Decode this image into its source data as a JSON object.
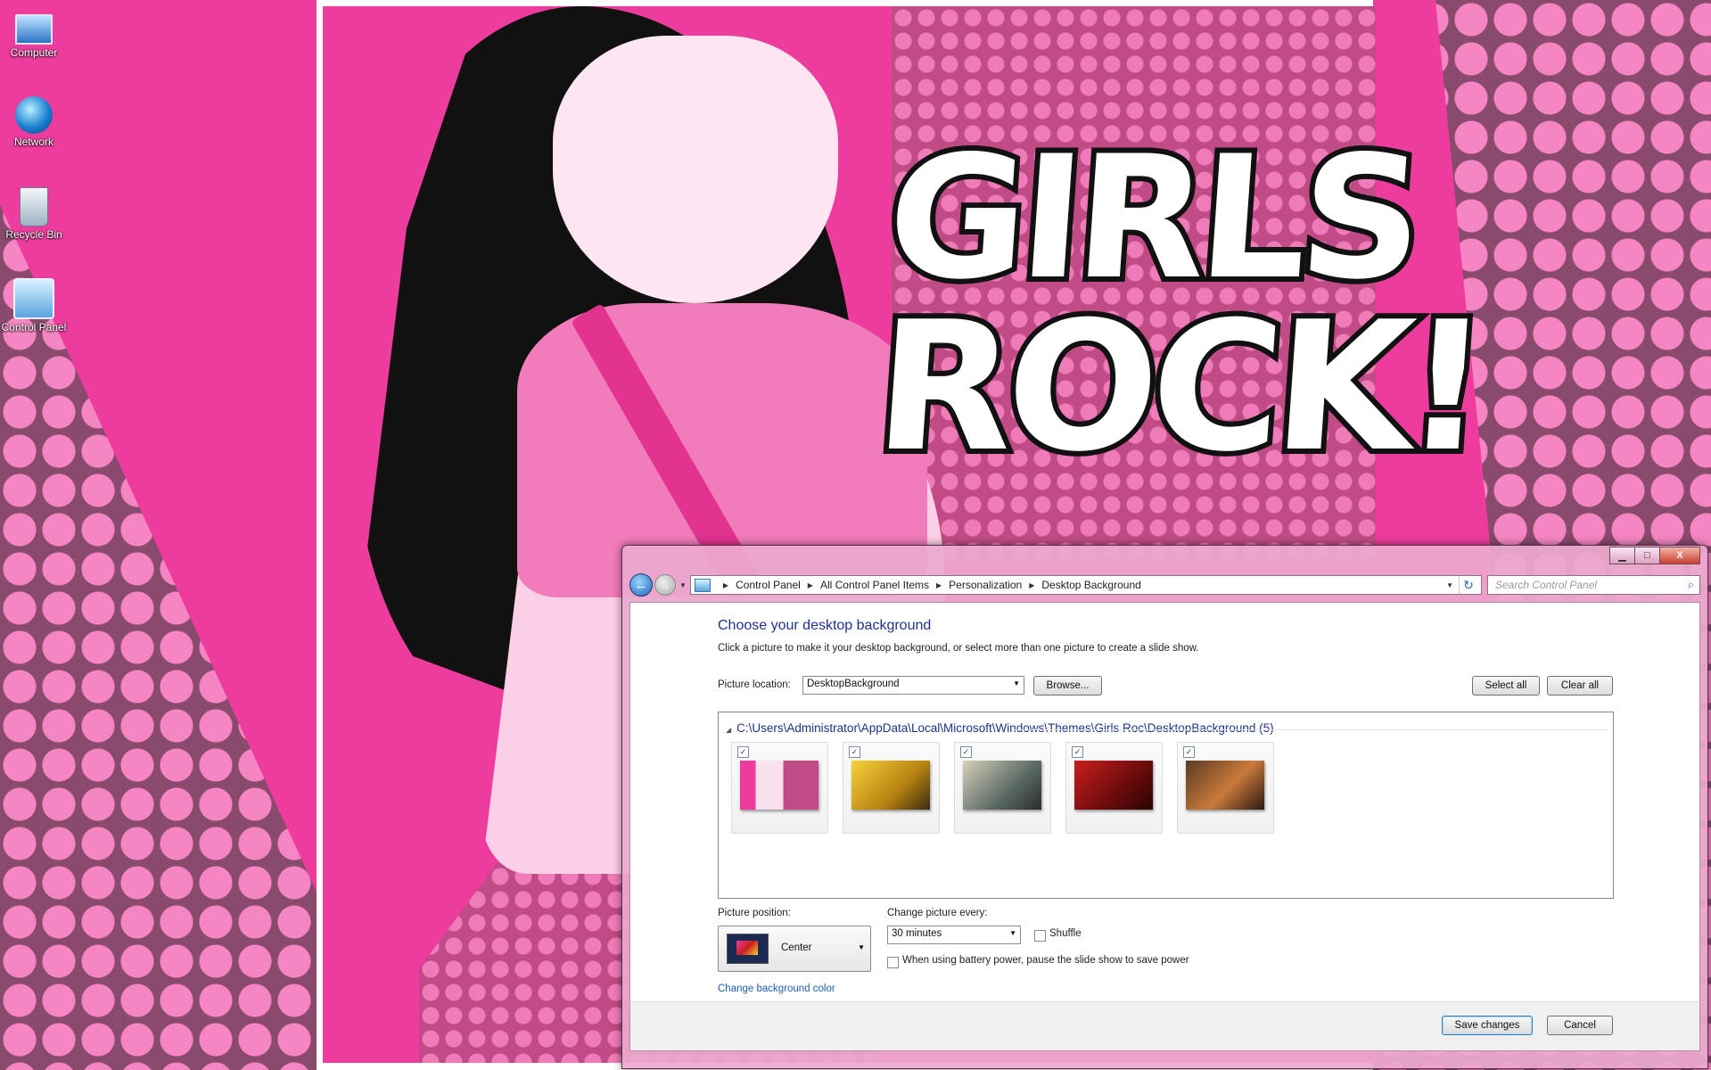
{
  "desktop": {
    "wallpaper_text": "GIRLS ROCK!",
    "icons": [
      {
        "label": "Computer",
        "icon": "computer-icon"
      },
      {
        "label": "Network",
        "icon": "network-icon"
      },
      {
        "label": "Recycle Bin",
        "icon": "recycle-bin-icon"
      },
      {
        "label": "Control Panel",
        "icon": "control-panel-icon"
      }
    ]
  },
  "window": {
    "controls": {
      "minimize": "▁",
      "maximize": "□",
      "close": "X"
    },
    "breadcrumb": [
      "Control Panel",
      "All Control Panel Items",
      "Personalization",
      "Desktop Background"
    ],
    "search_placeholder": "Search Control Panel",
    "heading": "Choose your desktop background",
    "description": "Click a picture to make it your desktop background, or select more than one picture to create a slide show.",
    "picture_location_label": "Picture location:",
    "picture_location_value": "DesktopBackground",
    "browse_label": "Browse...",
    "select_all_label": "Select all",
    "clear_all_label": "Clear all",
    "group_header": "C:\\Users\\Administrator\\AppData\\Local\\Microsoft\\Windows\\Themes\\Girls Roc\\DesktopBackground (5)",
    "thumbnails": [
      {
        "checked": true
      },
      {
        "checked": true
      },
      {
        "checked": true
      },
      {
        "checked": true
      },
      {
        "checked": true
      }
    ],
    "picture_position_label": "Picture position:",
    "picture_position_value": "Center",
    "change_every_label": "Change picture every:",
    "change_every_value": "30 minutes",
    "shuffle_label": "Shuffle",
    "battery_label": "When using battery power, pause the slide show to save power",
    "change_color_link": "Change background color",
    "save_label": "Save changes",
    "cancel_label": "Cancel"
  },
  "colors": {
    "wallpaper_pink": "#ee3c9e",
    "heading_blue": "#1e3287",
    "link_blue": "#1f5ea8",
    "window_frame": "#eca9ce"
  }
}
